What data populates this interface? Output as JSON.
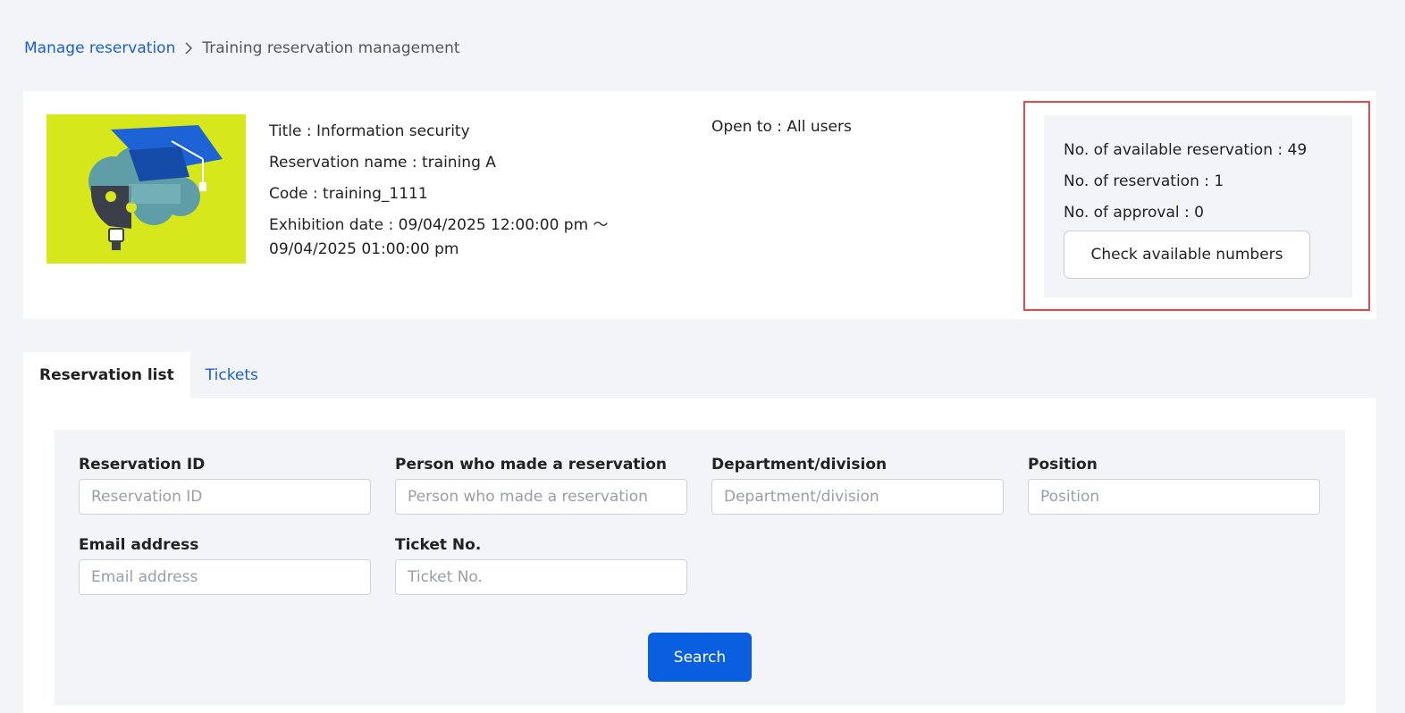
{
  "breadcrumb": {
    "parent": "Manage reservation",
    "current": "Training reservation management"
  },
  "training": {
    "title": "Title : Information security",
    "reservation_name": "Reservation name : training A",
    "code": "Code : training_1111",
    "exhibition_line1": "Exhibition date : 09/04/2025 12:00:00 pm ～",
    "exhibition_line2": "09/04/2025 01:00:00 pm",
    "open_to": "Open to : All users",
    "image_icon": "graduation-cap-brain-bulb-illustration"
  },
  "stats": {
    "available": "No. of available reservation : 49",
    "reservations": "No. of reservation : 1",
    "approvals": "No. of approval : 0",
    "check_button": "Check available numbers"
  },
  "tabs": [
    {
      "label": "Reservation list",
      "active": true
    },
    {
      "label": "Tickets",
      "active": false
    }
  ],
  "search": {
    "fields": [
      {
        "label": "Reservation ID",
        "placeholder": "Reservation ID",
        "value": ""
      },
      {
        "label": "Person who made a reservation",
        "placeholder": "Person who made a reservation",
        "value": ""
      },
      {
        "label": "Department/division",
        "placeholder": "Department/division",
        "value": ""
      },
      {
        "label": "Position",
        "placeholder": "Position",
        "value": ""
      },
      {
        "label": "Email address",
        "placeholder": "Email address",
        "value": ""
      },
      {
        "label": "Ticket No.",
        "placeholder": "Ticket No.",
        "value": ""
      }
    ],
    "button": "Search"
  },
  "colors": {
    "link": "#1a5fd1",
    "primary_button": "#0a5fe0",
    "highlight_border": "#e24b4b",
    "thumbnail_bg": "#d6e81c"
  }
}
